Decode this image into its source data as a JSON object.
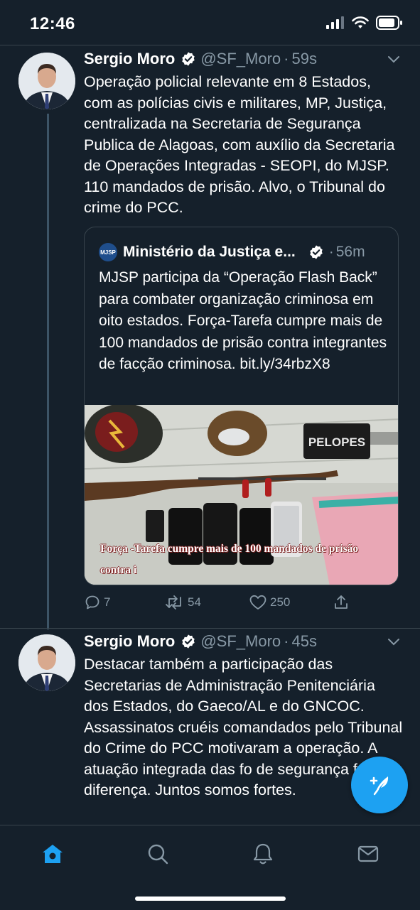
{
  "status_bar": {
    "time": "12:46"
  },
  "tweets": [
    {
      "name": "Sergio Moro",
      "handle": "@SF_Moro",
      "time": "59s",
      "text": "Operação policial relevante em 8 Estados, com as polícias civis e militares, MP, Justiça, centralizada na Secretaria de Segurança Publica de Alagoas, com auxílio da Secretaria de Operações Integradas - SEOPI, do MJSP. 110 mandados de prisão. Alvo, o Tribunal do crime do PCC.",
      "quote": {
        "logo": "MJSP",
        "name": "Ministério da Justiça e...",
        "time": "56m",
        "text": "MJSP participa da “Operação Flash Back” para combater organização criminosa em oito estados. Força-Tarefa cumpre mais de 100 mandados de prisão contra integrantes de facção criminosa. bit.ly/34rbzX8",
        "media_caption": "Força -Tarefa cumpre mais de 100 mandados de prisão contra i",
        "media_patch_label": "PELOPES"
      },
      "replies": "7",
      "retweets": "54",
      "likes": "250"
    },
    {
      "name": "Sergio Moro",
      "handle": "@SF_Moro",
      "time": "45s",
      "text": "Destacar também a participação das Secretarias de Administração Penitenciária dos Estados, do Gaeco/AL e do GNCOC. Assassinatos cruéis comandados pelo Tribunal do Crime do PCC motivaram a operação. A atuação integrada das fo de segurança faz a diferença. Juntos somos fortes."
    }
  ],
  "separator": "·",
  "colors": {
    "background": "#15202b",
    "accent": "#1da1f2",
    "muted": "#8899a6",
    "border": "#38444d"
  },
  "icons": [
    "signal-icon",
    "wifi-icon",
    "battery-icon",
    "verified-icon",
    "chevron-down-icon",
    "reply-icon",
    "retweet-icon",
    "like-icon",
    "share-icon",
    "compose-tweet-icon",
    "home-icon",
    "search-icon",
    "notifications-icon",
    "messages-icon"
  ]
}
